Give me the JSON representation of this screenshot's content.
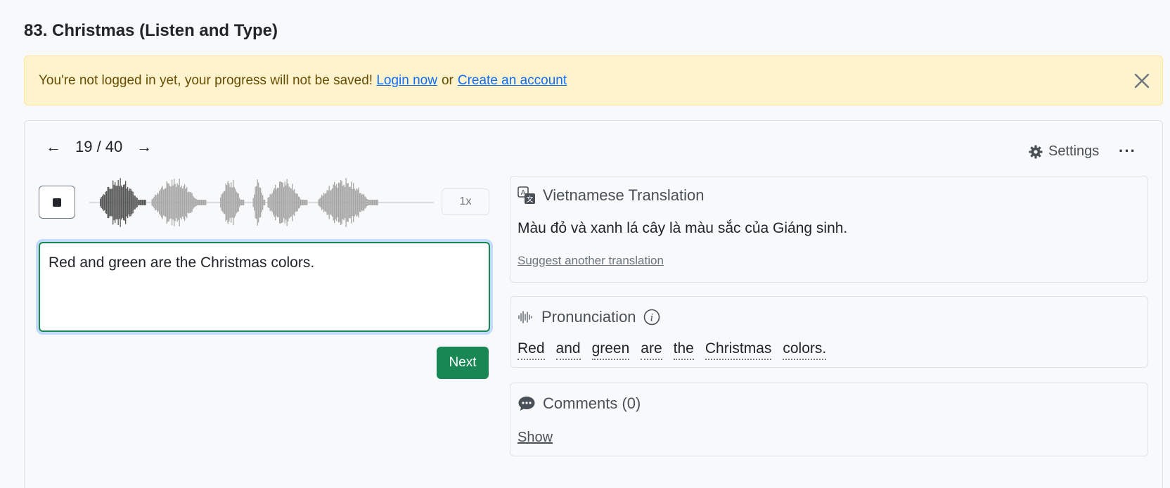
{
  "page": {
    "title": "83. Christmas (Listen and Type)"
  },
  "alert": {
    "message": "You're not logged in yet, your progress will not be saved!",
    "login_label": "Login now",
    "or_label": "or",
    "create_label": "Create an account",
    "close_icon": "close-icon"
  },
  "nav": {
    "prev_label": "←",
    "counter": "19 / 40",
    "next_label": "→"
  },
  "toolbar": {
    "settings_label": "Settings",
    "settings_icon": "gear-icon",
    "more_label": "···"
  },
  "player": {
    "state": "playing",
    "speed_label": "1x",
    "played_fraction": 0.18
  },
  "answer": {
    "value": "Red and green are the Christmas colors."
  },
  "next_button": {
    "label": "Next"
  },
  "translation": {
    "title": "Vietnamese Translation",
    "text": "Màu đỏ và xanh lá cây là màu sắc của Giáng sinh.",
    "suggest_label": "Suggest another translation"
  },
  "pronunciation": {
    "title": "Pronunciation",
    "words": [
      "Red",
      "and",
      "green",
      "are",
      "the",
      "Christmas",
      "colors."
    ]
  },
  "comments": {
    "title": "Comments (0)",
    "show_label": "Show"
  },
  "colors": {
    "success": "#198754",
    "alert_bg": "#fff3cd",
    "link": "#0d6efd"
  }
}
